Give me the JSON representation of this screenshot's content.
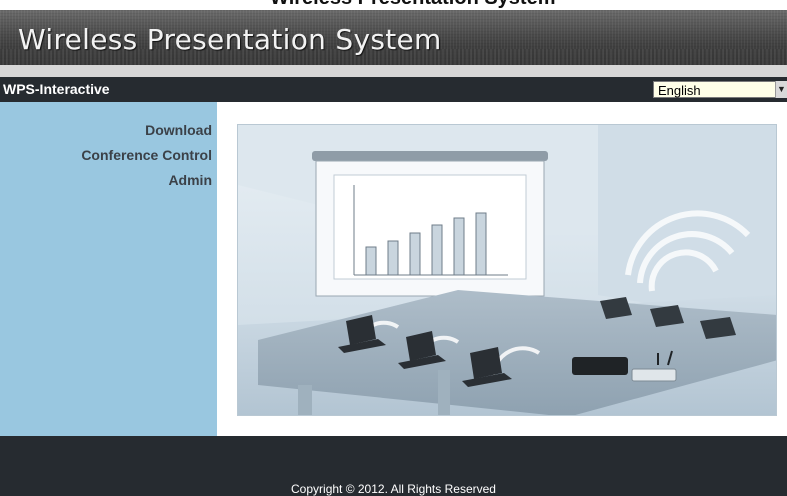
{
  "browser_overlay": {
    "title_fragment": "Wireless Presentation System"
  },
  "header": {
    "title": "Wireless Presentation System"
  },
  "navbar": {
    "brand": "WPS-Interactive",
    "language": {
      "selected": "English"
    }
  },
  "sidebar": {
    "items": [
      {
        "label": "Download"
      },
      {
        "label": "Conference Control"
      },
      {
        "label": "Admin"
      }
    ]
  },
  "illustration": {
    "subject": "conference-room-wireless-presentation"
  },
  "footer": {
    "copyright": "Copyright © 2012. All Rights Reserved"
  }
}
